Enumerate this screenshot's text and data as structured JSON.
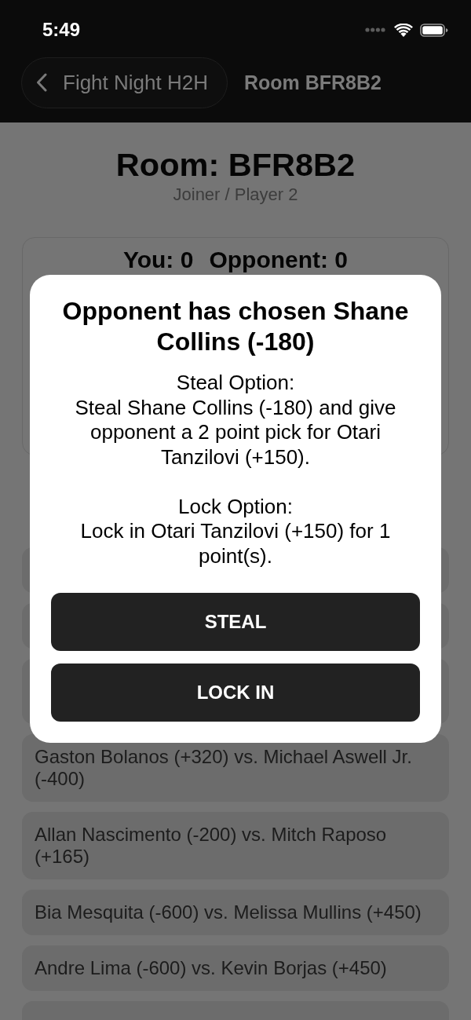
{
  "status_bar": {
    "time": "5:49"
  },
  "nav_bar": {
    "back_label": "Fight Night H2H",
    "title": "Room BFR8B2"
  },
  "room": {
    "title": "Room: BFR8B2",
    "role": "Joiner / Player 2"
  },
  "score": {
    "you": "You: 0",
    "opponent": "Opponent: 0"
  },
  "fights": [
    {
      "kind": "covered"
    },
    {
      "kind": "covered"
    },
    {
      "kind": "covered"
    },
    {
      "kind": "fight",
      "label": "Gaston Bolanos (+320) vs. Michael Aswell Jr. (-400)"
    },
    {
      "kind": "fight",
      "label": "Allan Nascimento (-200) vs. Mitch Raposo (+165)"
    },
    {
      "kind": "fight",
      "label": "Bia Mesquita (-600) vs. Melissa Mullins (+450)"
    },
    {
      "kind": "fight",
      "label": "Andre Lima (-600) vs. Kevin Borjas (+450)"
    },
    {
      "kind": "covered"
    }
  ],
  "dialog": {
    "title": "Opponent has chosen Shane Collins (-180)",
    "message": "Steal Option:\nSteal Shane Collins (-180) and give opponent a 2 point pick for Otari Tanzilovi (+150).\n\nLock Option:\nLock in Otari Tanzilovi (+150) for 1 point(s).",
    "buttons": [
      "STEAL",
      "LOCK IN"
    ]
  }
}
